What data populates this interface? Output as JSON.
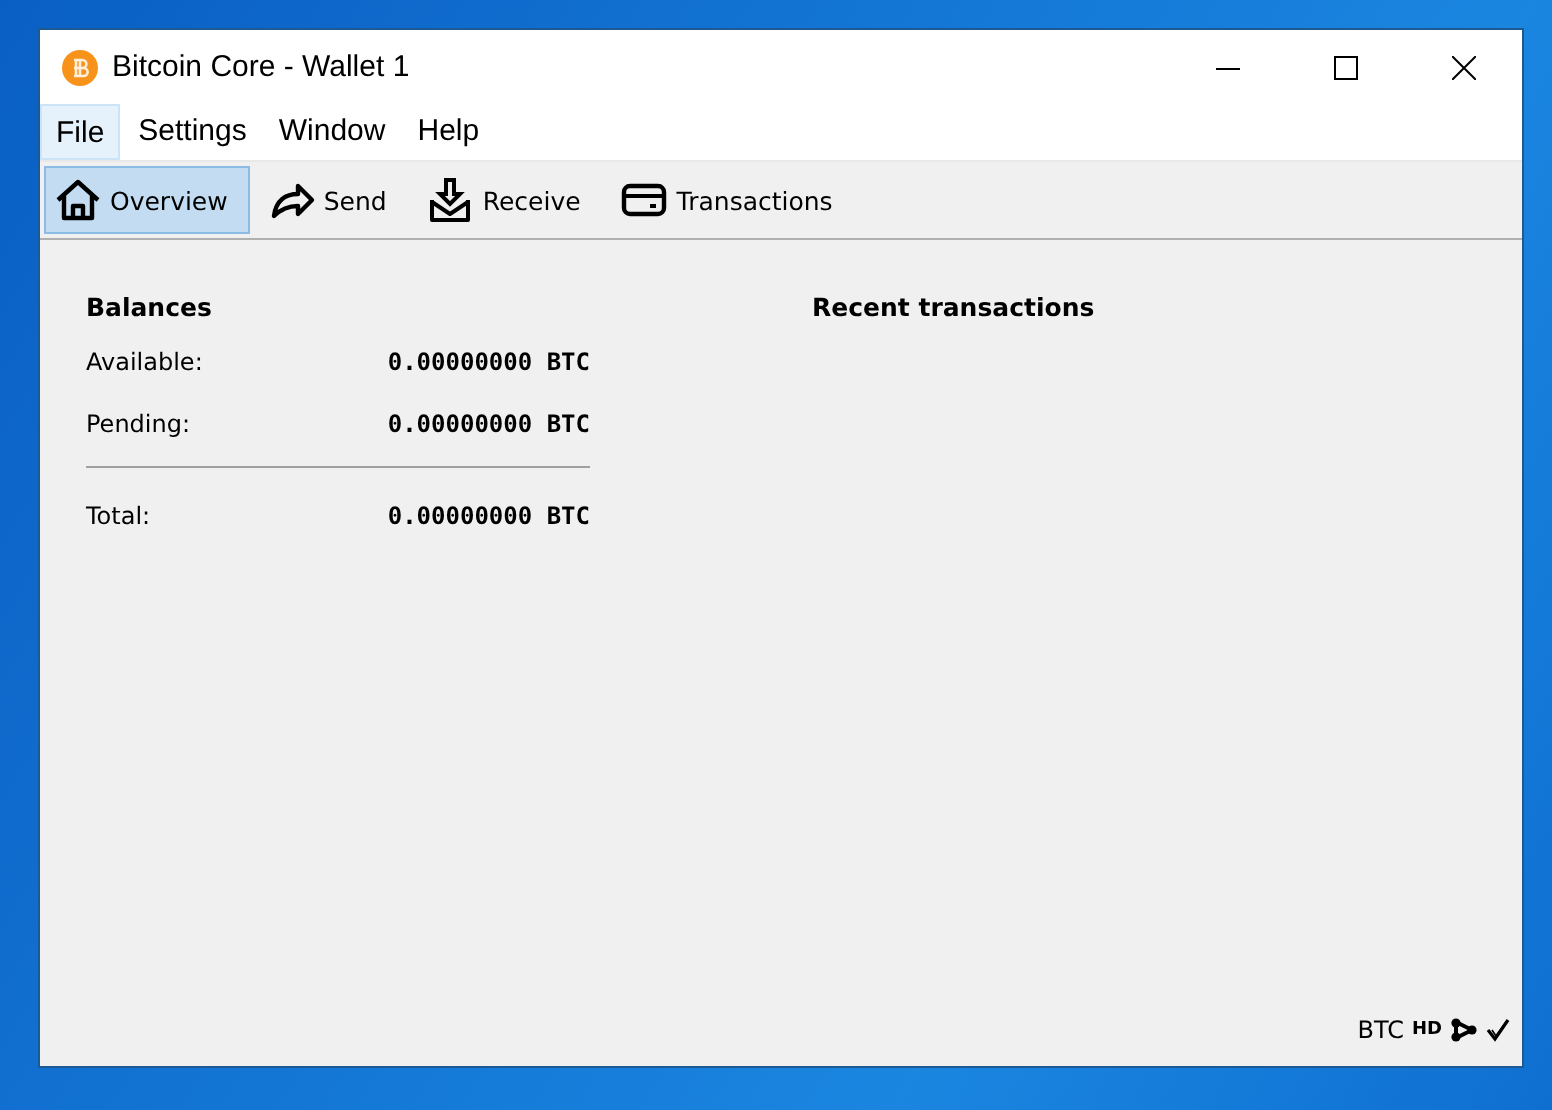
{
  "window": {
    "title": "Bitcoin Core - Wallet 1"
  },
  "menu": [
    {
      "label": "File",
      "selected": true
    },
    {
      "label": "Settings",
      "selected": false
    },
    {
      "label": "Window",
      "selected": false
    },
    {
      "label": "Help",
      "selected": false
    }
  ],
  "toolbar": [
    {
      "label": "Overview",
      "kind": "home",
      "selected": true
    },
    {
      "label": "Send",
      "kind": "send",
      "selected": false
    },
    {
      "label": "Receive",
      "kind": "receive",
      "selected": false
    },
    {
      "label": "Transactions",
      "kind": "transactions",
      "selected": false
    }
  ],
  "balances": {
    "title": "Balances",
    "rows": [
      {
        "label": "Available:",
        "value": "0.00000000 BTC"
      },
      {
        "label": "Pending:",
        "value": "0.00000000 BTC"
      },
      {
        "label": "Total:",
        "value": "0.00000000 BTC",
        "separated": true
      }
    ]
  },
  "recent": {
    "title": "Recent transactions"
  },
  "status_bar": {
    "unit": "BTC",
    "hd": "HD"
  }
}
